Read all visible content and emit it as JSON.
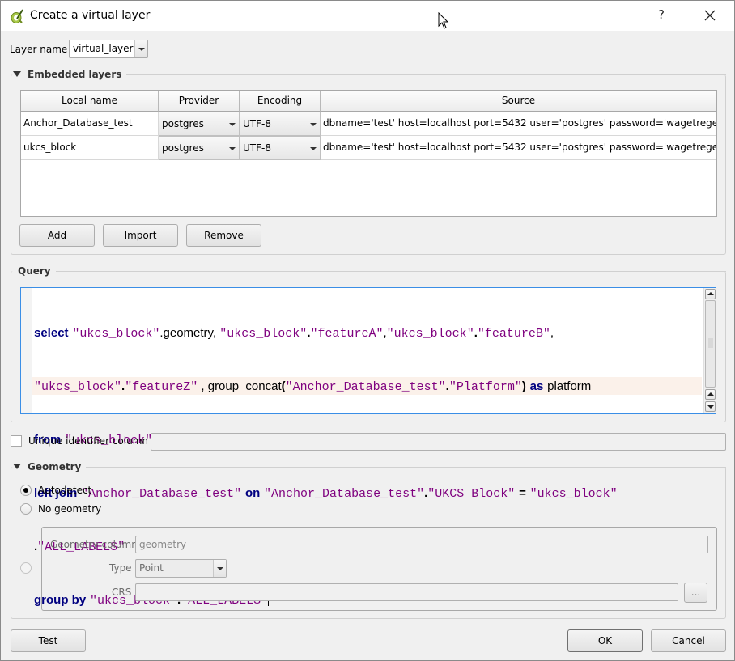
{
  "window": {
    "title": "Create a virtual layer",
    "help_label": "?",
    "close_icon": "close-icon",
    "app_icon": "qgis-icon"
  },
  "layer_name": {
    "label": "Layer name",
    "value": "virtual_layer"
  },
  "embedded_layers": {
    "title": "Embedded layers",
    "columns": [
      "Local name",
      "Provider",
      "Encoding",
      "Source"
    ],
    "rows": [
      {
        "local_name": "Anchor_Database_test",
        "provider": "postgres",
        "encoding": "UTF-8",
        "source": "dbname='test' host=localhost port=5432 user='postgres' password='wagetregen'..."
      },
      {
        "local_name": "ukcs_block",
        "provider": "postgres",
        "encoding": "UTF-8",
        "source": "dbname='test' host=localhost port=5432 user='postgres' password='wagetregen'..."
      }
    ],
    "buttons": {
      "add": "Add",
      "import": "Import",
      "remove": "Remove"
    }
  },
  "query": {
    "title": "Query",
    "tokens": {
      "select": "select",
      "ukcs_block_q": "\"ukcs_block\"",
      "geometry": ".geometry, ",
      "dot": ".",
      "featureA": "\"featureA\"",
      "comma": ",",
      "featureB": "\"featureB\"",
      "featureZ": "\"featureZ\"",
      "group_concat": " , group_concat",
      "lparen": "(",
      "anchor_q": "\"Anchor_Database_test\"",
      "platform_q": "\"Platform\"",
      "rparen": ")",
      "as": "as",
      "platform": "platform",
      "from": "from",
      "left_join": "left join",
      "on": "on",
      "ukcs_block_col": "\"UKCS Block\"",
      "eq": "=",
      "all_labels": "\"ALL_LABELS\"",
      "group_by": "group by"
    }
  },
  "unique_id": {
    "label": "Unique identifier column",
    "checked": false,
    "value": ""
  },
  "geometry": {
    "title": "Geometry",
    "options": [
      "Autodetect",
      "No geometry"
    ],
    "selected": "Autodetect",
    "geometry_column_label": "Geometry column",
    "geometry_column_value": "geometry",
    "type_label": "Type",
    "type_value": "Point",
    "crs_label": "CRS",
    "crs_value": "",
    "crs_button": "..."
  },
  "footer": {
    "test": "Test",
    "ok": "OK",
    "cancel": "Cancel"
  }
}
